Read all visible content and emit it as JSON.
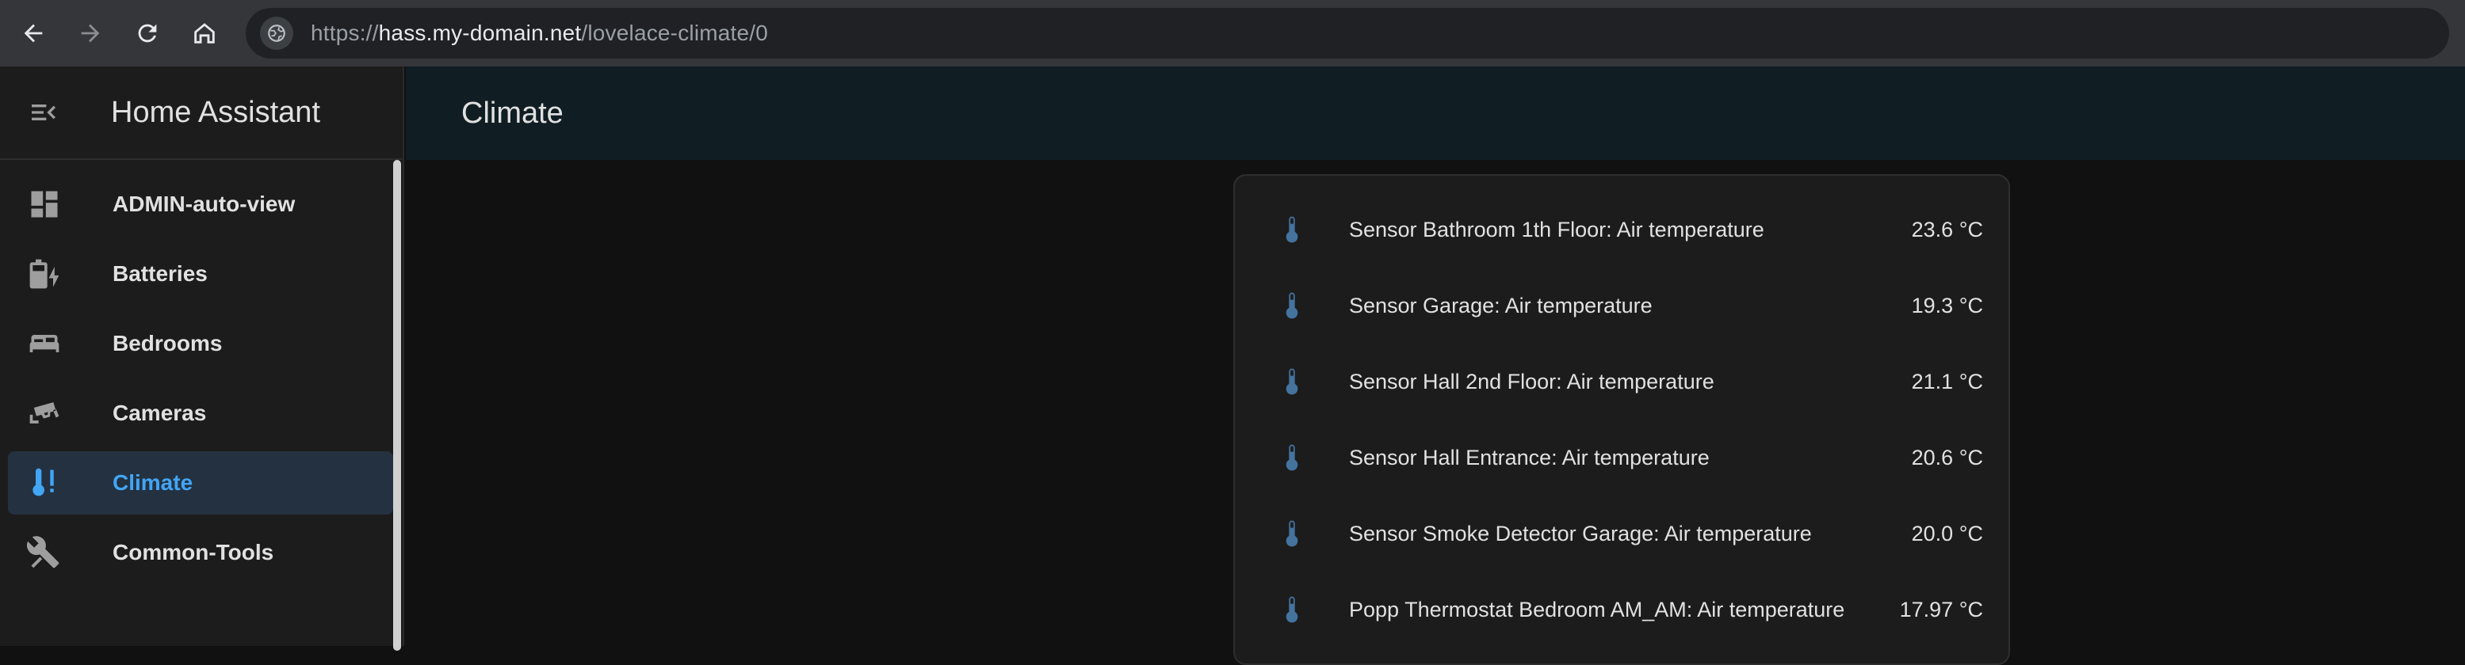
{
  "browser": {
    "url_scheme": "https://",
    "url_host": "hass.my-domain.net",
    "url_path": "/lovelace-climate/0"
  },
  "sidebar": {
    "title": "Home Assistant",
    "items": [
      {
        "label": "ADMIN-auto-view",
        "icon": "view-dashboard-icon",
        "active": false
      },
      {
        "label": "Batteries",
        "icon": "battery-charging-icon",
        "active": false
      },
      {
        "label": "Bedrooms",
        "icon": "bed-icon",
        "active": false
      },
      {
        "label": "Cameras",
        "icon": "cctv-icon",
        "active": false
      },
      {
        "label": "Climate",
        "icon": "thermometer-alert-icon",
        "active": true
      },
      {
        "label": "Common-Tools",
        "icon": "tools-icon",
        "active": false
      }
    ]
  },
  "header": {
    "title": "Climate"
  },
  "entities": [
    {
      "name": "Sensor Bathroom 1th Floor: Air temperature",
      "value": "23.6 °C"
    },
    {
      "name": "Sensor Garage: Air temperature",
      "value": "19.3 °C"
    },
    {
      "name": "Sensor Hall 2nd Floor: Air temperature",
      "value": "21.1 °C"
    },
    {
      "name": "Sensor Hall Entrance: Air temperature",
      "value": "20.6 °C"
    },
    {
      "name": "Sensor Smoke Detector Garage: Air temperature",
      "value": "20.0 °C"
    },
    {
      "name": "Popp Thermostat Bedroom AM_AM: Air temperature",
      "value": "17.97 °C"
    }
  ],
  "colors": {
    "accent": "#42a5f5",
    "entity_icon": "#44739e",
    "sidebar_icon": "#9e9e9e"
  }
}
